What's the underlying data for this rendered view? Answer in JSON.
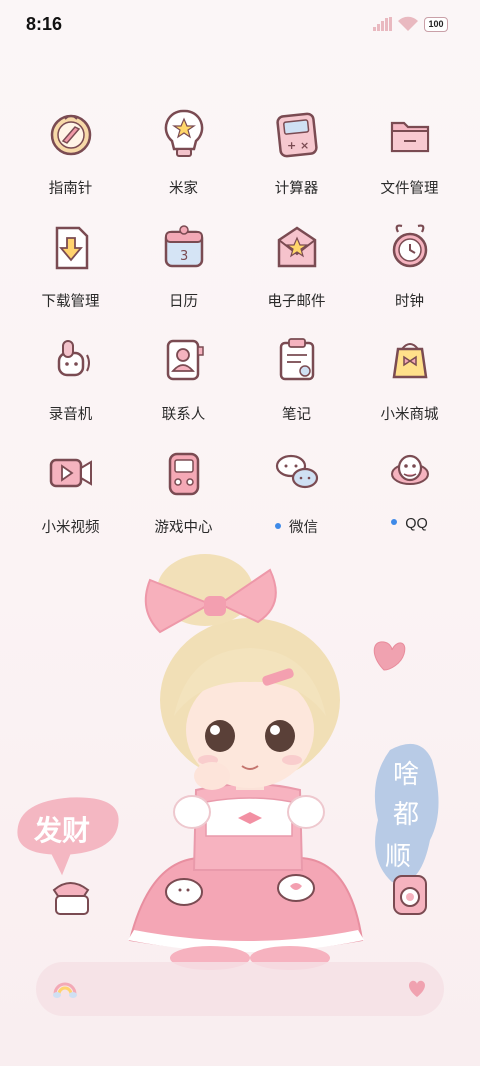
{
  "status": {
    "time": "8:16",
    "battery": "100"
  },
  "apps": [
    {
      "label": "指南针",
      "icon": "compass-icon"
    },
    {
      "label": "米家",
      "icon": "mijia-icon"
    },
    {
      "label": "计算器",
      "icon": "calculator-icon"
    },
    {
      "label": "文件管理",
      "icon": "folder-icon"
    },
    {
      "label": "下载管理",
      "icon": "download-icon"
    },
    {
      "label": "日历",
      "icon": "calendar-icon",
      "calendar_day": "3"
    },
    {
      "label": "电子邮件",
      "icon": "mail-icon"
    },
    {
      "label": "时钟",
      "icon": "clock-icon"
    },
    {
      "label": "录音机",
      "icon": "recorder-icon"
    },
    {
      "label": "联系人",
      "icon": "contacts-icon"
    },
    {
      "label": "笔记",
      "icon": "notes-icon"
    },
    {
      "label": "小米商城",
      "icon": "shop-icon"
    },
    {
      "label": "小米视频",
      "icon": "video-icon"
    },
    {
      "label": "游戏中心",
      "icon": "game-icon"
    },
    {
      "label": "微信",
      "icon": "wechat-icon",
      "badge": true
    },
    {
      "label": "QQ",
      "icon": "qq-icon",
      "badge": true
    }
  ],
  "wallpaper": {
    "left_bubble": "发财",
    "right_bubble_chars": [
      "啥",
      "都",
      "顺"
    ]
  },
  "colors": {
    "accent_pink": "#f1a9b6",
    "badge_blue": "#3f8ae8",
    "outline": "#7a4b52",
    "bubble_blue": "#b8cbe6"
  }
}
